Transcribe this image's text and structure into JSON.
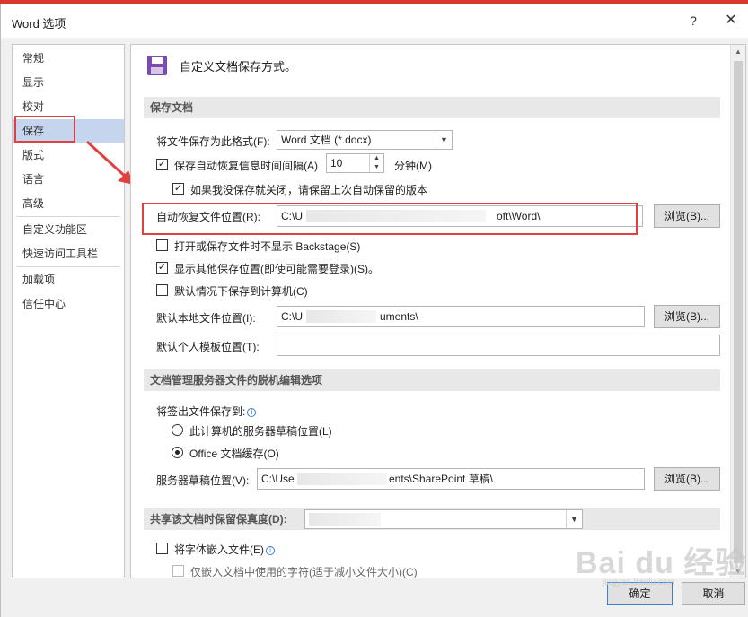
{
  "window": {
    "title": "Word 选项",
    "help": "?",
    "close": "✕"
  },
  "nav": {
    "items": [
      {
        "label": "常规"
      },
      {
        "label": "显示"
      },
      {
        "label": "校对"
      },
      {
        "label": "保存",
        "selected": true
      },
      {
        "label": "版式"
      },
      {
        "label": "语言"
      },
      {
        "label": "高级"
      },
      {
        "label": "自定义功能区"
      },
      {
        "label": "快速访问工具栏"
      },
      {
        "label": "加载项"
      },
      {
        "label": "信任中心"
      }
    ]
  },
  "content": {
    "header": "自定义文档保存方式。",
    "save_section": {
      "title": "保存文档",
      "format_label": "将文件保存为此格式(F):",
      "format_value": "Word 文档 (*.docx)",
      "autorecover_label": "保存自动恢复信息时间间隔(A)",
      "autorecover_checked": true,
      "autorecover_minutes": "10",
      "minutes_label": "分钟(M)",
      "keep_last_label": "如果我没保存就关闭，请保留上次自动保留的版本",
      "keep_last_checked": true,
      "autorecover_location_label": "自动恢复文件位置(R):",
      "autorecover_location_start": "C:\\U",
      "autorecover_location_end": "oft\\Word\\",
      "browse_label_1": "浏览(B)...",
      "no_backstage_label": "打开或保存文件时不显示 Backstage(S)",
      "no_backstage_checked": false,
      "show_other_label": "显示其他保存位置(即使可能需要登录)(S)。",
      "show_other_checked": true,
      "save_to_computer_label": "默认情况下保存到计算机(C)",
      "save_to_computer_checked": false,
      "default_local_label": "默认本地文件位置(I):",
      "default_local_start": "C:\\U",
      "default_local_end": "uments\\",
      "browse_label_2": "浏览(B)...",
      "default_template_label": "默认个人模板位置(T):",
      "default_template_value": ""
    },
    "offline_section": {
      "title": "文档管理服务器文件的脱机编辑选项",
      "checkout_label": "将签出文件保存到:",
      "option_server_drafts": "此计算机的服务器草稿位置(L)",
      "option_office_cache": "Office 文档缓存(O)",
      "selected_option": "Office 文档缓存(O)",
      "server_drafts_label": "服务器草稿位置(V):",
      "server_drafts_start": "C:\\Use",
      "server_drafts_end": "ents\\SharePoint 草稿\\",
      "browse_label_3": "浏览(B)..."
    },
    "fidelity_section": {
      "title": "共享该文档时保留保真度(D):",
      "document_value": "",
      "embed_fonts_label": "将字体嵌入文件(E)",
      "embed_fonts_checked": false,
      "embed_used_chars_label": "仅嵌入文档中使用的字符(适于减小文件大小)(C)",
      "embed_used_chars_checked": false
    }
  },
  "footer": {
    "ok_label": "确定",
    "cancel_label": "取消"
  },
  "watermark": {
    "text": "Bai du 经验",
    "sub": "jingyan.baidu.com"
  },
  "colors": {
    "annotation_red": "#e04040",
    "selected_nav": "#c5d5ee",
    "section_bg": "#e8e8e8"
  }
}
